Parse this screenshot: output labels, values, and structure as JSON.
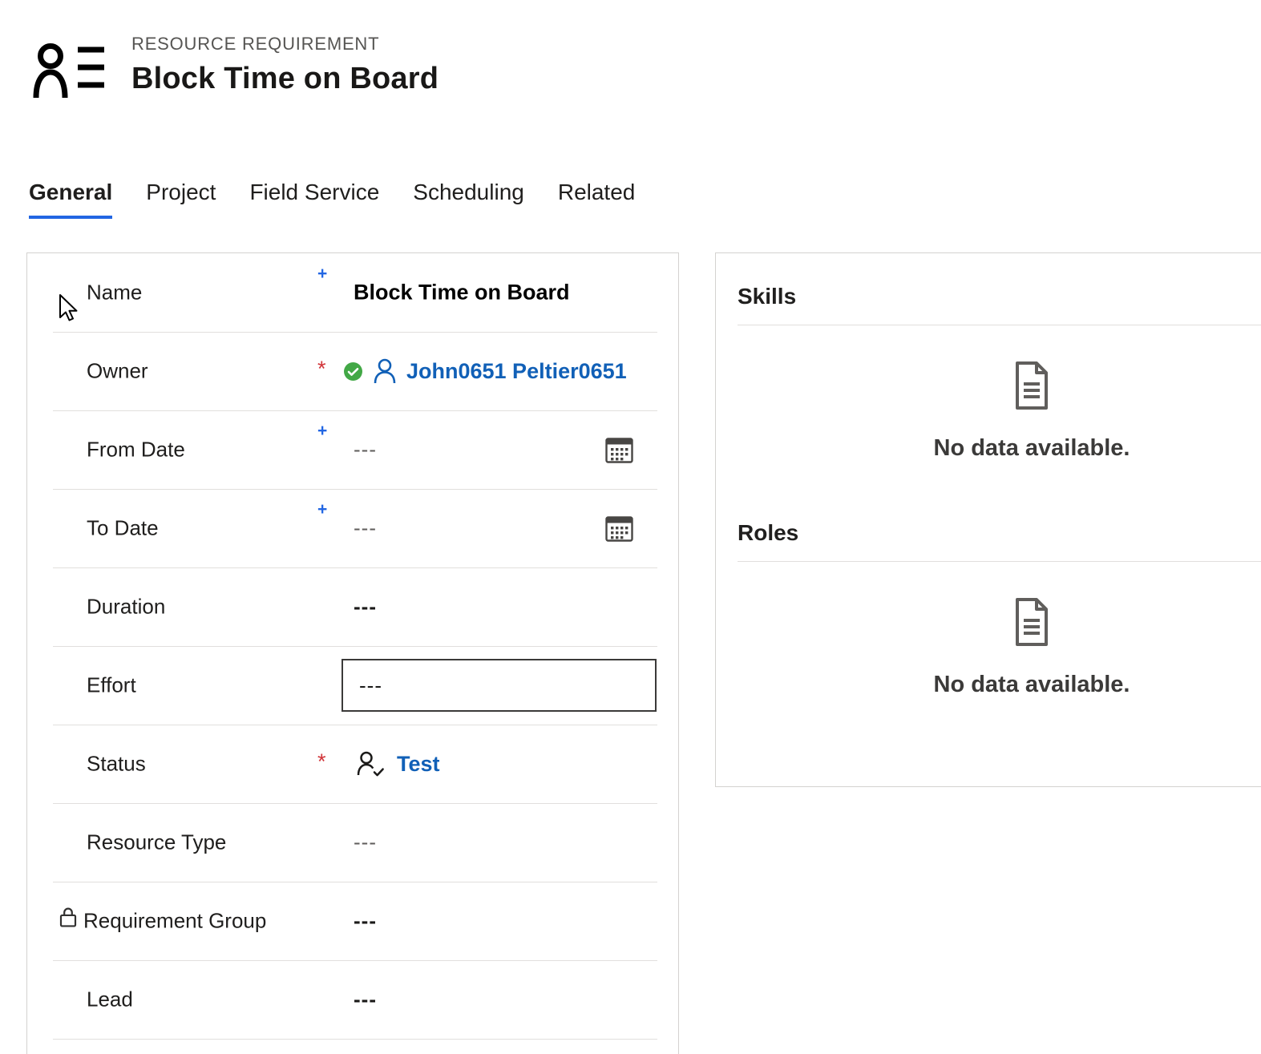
{
  "colors": {
    "accent_blue": "#2266E3",
    "link_blue": "#1160B7",
    "required_red": "#D13438",
    "check_green": "#42A846",
    "divider_gray": "#E1DFDD",
    "muted_gray": "#605E5C",
    "label_dark": "#1B1A19"
  },
  "header": {
    "entity_label": "RESOURCE REQUIREMENT",
    "title": "Block Time on Board"
  },
  "tabs": [
    {
      "label": "General",
      "active": true
    },
    {
      "label": "Project",
      "active": false
    },
    {
      "label": "Field Service",
      "active": false
    },
    {
      "label": "Scheduling",
      "active": false
    },
    {
      "label": "Related",
      "active": false
    }
  ],
  "form": {
    "fields": [
      {
        "label": "Name",
        "marker": "+",
        "value": "Block Time on Board"
      },
      {
        "label": "Owner",
        "marker": "*",
        "value": "John0651 Peltier0651"
      },
      {
        "label": "From Date",
        "marker": "+",
        "value": "---"
      },
      {
        "label": "To Date",
        "marker": "+",
        "value": "---"
      },
      {
        "label": "Duration",
        "marker": "",
        "value": "---"
      },
      {
        "label": "Effort",
        "marker": "",
        "value": "---"
      },
      {
        "label": "Status",
        "marker": "*",
        "value": "Test"
      },
      {
        "label": "Resource Type",
        "marker": "",
        "value": "---"
      },
      {
        "label": "Requirement Group",
        "marker": "",
        "value": "---"
      },
      {
        "label": "Lead",
        "marker": "",
        "value": "---"
      }
    ]
  },
  "side_panels": [
    {
      "title": "Skills",
      "empty_message": "No data available."
    },
    {
      "title": "Roles",
      "empty_message": "No data available."
    }
  ]
}
